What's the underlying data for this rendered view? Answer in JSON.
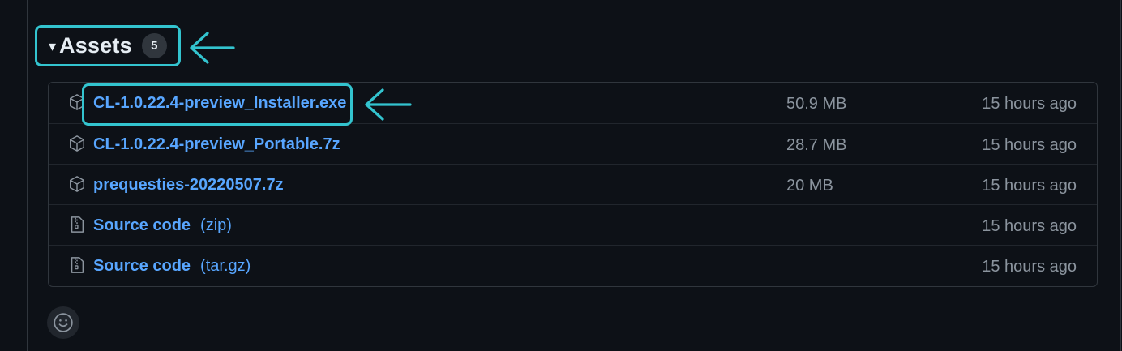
{
  "assets": {
    "title": "Assets",
    "count": "5",
    "caret_icon": "triangle-down-icon",
    "items": [
      {
        "name": "CL-1.0.22.4-preview_Installer.exe",
        "suffix": "",
        "size": "50.9 MB",
        "time": "15 hours ago",
        "icon": "package-icon"
      },
      {
        "name": "CL-1.0.22.4-preview_Portable.7z",
        "suffix": "",
        "size": "28.7 MB",
        "time": "15 hours ago",
        "icon": "package-icon"
      },
      {
        "name": "prequesties-20220507.7z",
        "suffix": "",
        "size": "20 MB",
        "time": "15 hours ago",
        "icon": "package-icon"
      },
      {
        "name": "Source code",
        "suffix": "(zip)",
        "size": "",
        "time": "15 hours ago",
        "icon": "file-zip-icon"
      },
      {
        "name": "Source code",
        "suffix": "(tar.gz)",
        "size": "",
        "time": "15 hours ago",
        "icon": "file-zip-icon"
      }
    ]
  },
  "annotations": {
    "highlight_color": "#33c4cf",
    "arrows": [
      "arrow-left-icon",
      "arrow-left-icon"
    ]
  },
  "reactions": {
    "icon": "smiley-icon"
  },
  "colors": {
    "background": "#0d1117",
    "link": "#58a6ff",
    "muted": "#8b949e",
    "border": "#30363d"
  }
}
